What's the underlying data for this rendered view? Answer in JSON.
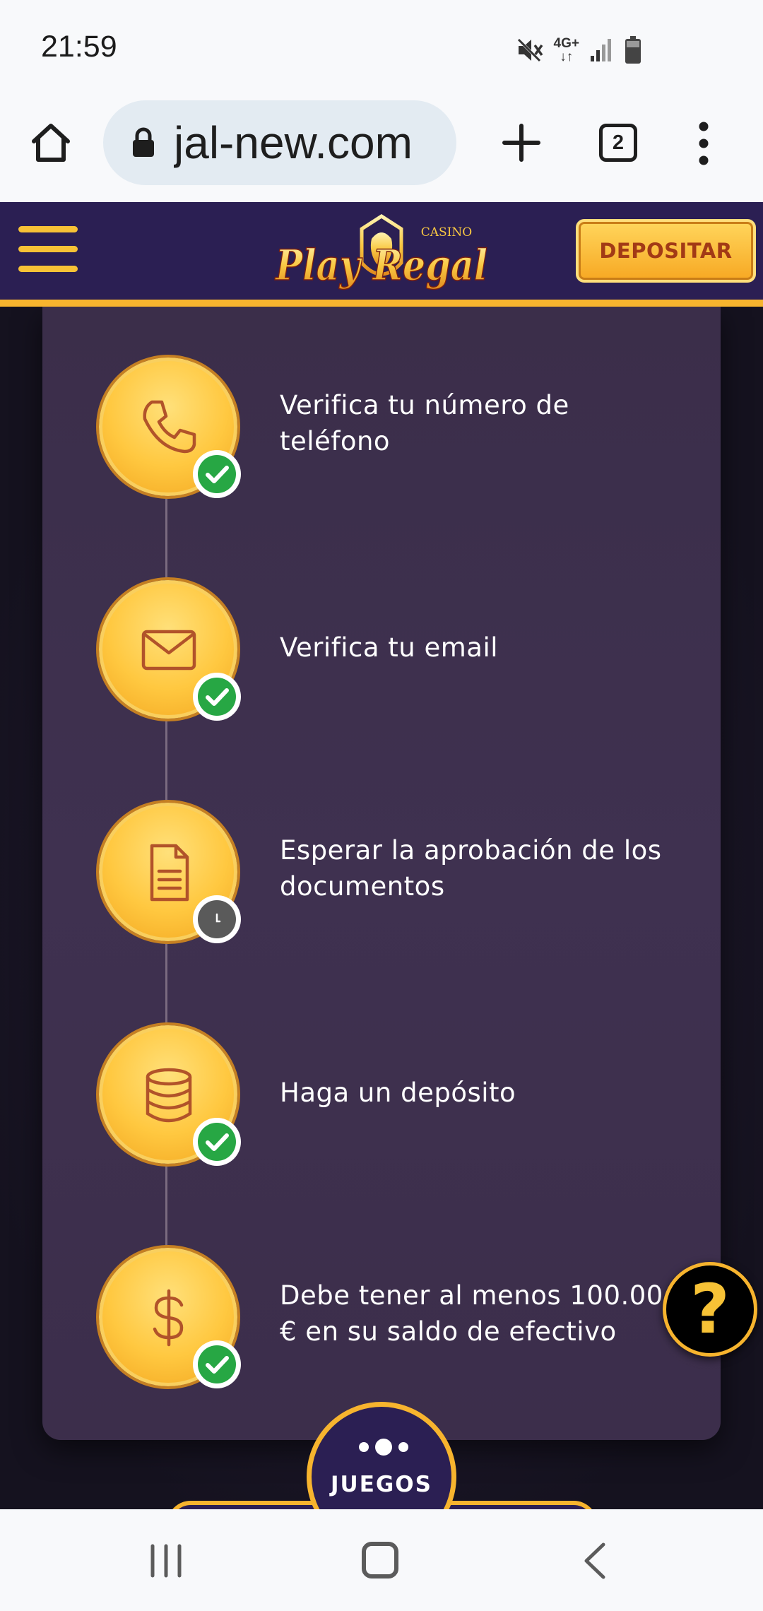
{
  "status_bar": {
    "time": "21:59",
    "network": "4G+",
    "icons": [
      "mute-icon",
      "network-4g-icon",
      "signal-icon",
      "battery-icon"
    ]
  },
  "browser": {
    "url": "jal-new.com",
    "tab_count": "2",
    "icons": [
      "home-icon",
      "lock-icon",
      "plus-icon",
      "tabs-icon",
      "more-vert-icon"
    ]
  },
  "site_header": {
    "logo_text": "Play Regal",
    "logo_subtext": "CASINO",
    "deposit_label": "DEPOSITAR",
    "colors": {
      "header_bg": "#2b1f53",
      "accent": "#f7b42e"
    }
  },
  "steps": [
    {
      "label": "Verifica tu número de teléfono",
      "icon": "phone-icon",
      "status": "completed"
    },
    {
      "label": "Verifica tu email",
      "icon": "mail-icon",
      "status": "completed"
    },
    {
      "label": "Esperar la aprobación de los documentos",
      "icon": "document-icon",
      "status": "pending"
    },
    {
      "label": "Haga un depósito",
      "icon": "database-icon",
      "status": "completed"
    },
    {
      "label": "Debe tener al menos 100.00 € en su saldo de efectivo",
      "icon": "dollar-icon",
      "status": "completed"
    }
  ],
  "help_button": {
    "label": "?"
  },
  "games_button": {
    "label": "JUEGOS"
  },
  "nav_bar": {
    "icons": [
      "recent-apps-icon",
      "home-nav-icon",
      "back-icon"
    ]
  }
}
